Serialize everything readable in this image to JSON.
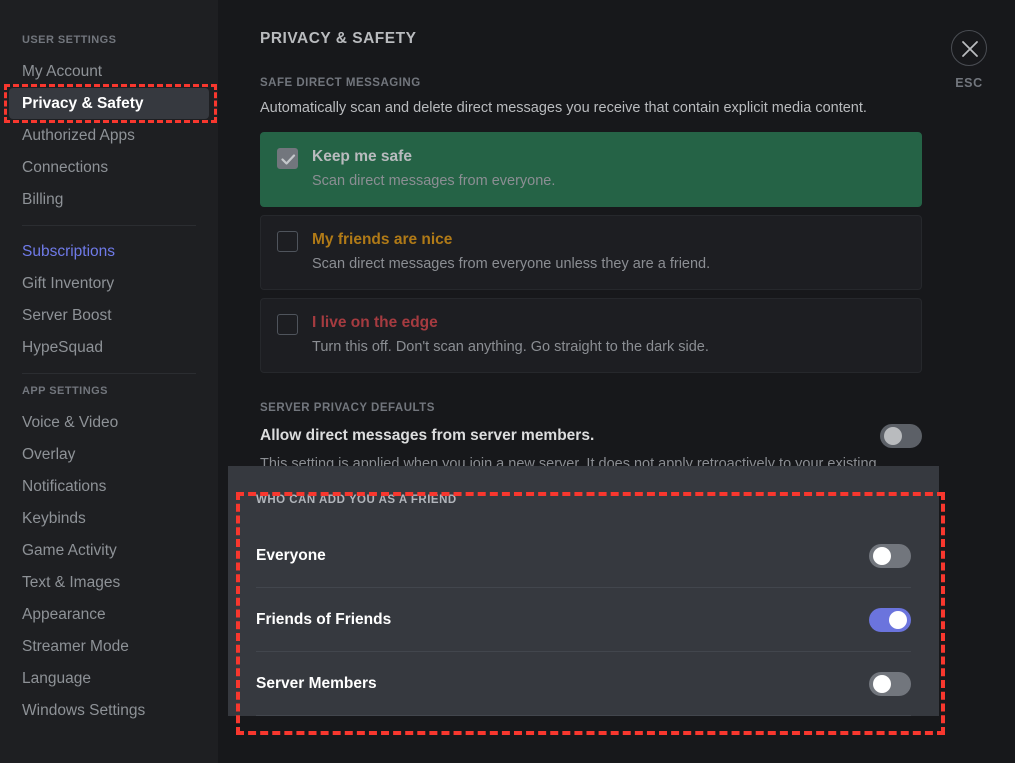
{
  "sidebar": {
    "user_settings_header": "USER SETTINGS",
    "app_settings_header": "APP SETTINGS",
    "user_items": [
      {
        "label": "My Account",
        "state": "normal"
      },
      {
        "label": "Privacy & Safety",
        "state": "active"
      },
      {
        "label": "Authorized Apps",
        "state": "normal"
      },
      {
        "label": "Connections",
        "state": "normal"
      },
      {
        "label": "Billing",
        "state": "normal"
      }
    ],
    "billing_items": [
      {
        "label": "Subscriptions",
        "state": "accent"
      },
      {
        "label": "Gift Inventory",
        "state": "normal"
      },
      {
        "label": "Server Boost",
        "state": "normal"
      },
      {
        "label": "HypeSquad",
        "state": "normal"
      }
    ],
    "app_items": [
      {
        "label": "Voice & Video",
        "state": "normal"
      },
      {
        "label": "Overlay",
        "state": "normal"
      },
      {
        "label": "Notifications",
        "state": "normal"
      },
      {
        "label": "Keybinds",
        "state": "normal"
      },
      {
        "label": "Game Activity",
        "state": "normal"
      },
      {
        "label": "Text & Images",
        "state": "normal"
      },
      {
        "label": "Appearance",
        "state": "normal"
      },
      {
        "label": "Streamer Mode",
        "state": "normal"
      },
      {
        "label": "Language",
        "state": "normal"
      },
      {
        "label": "Windows Settings",
        "state": "normal"
      }
    ]
  },
  "header": {
    "page_title": "PRIVACY & SAFETY"
  },
  "safe_dm": {
    "section_label": "SAFE DIRECT MESSAGING",
    "description": "Automatically scan and delete direct messages you receive that contain explicit media content.",
    "options": [
      {
        "title": "Keep me safe",
        "subtitle": "Scan direct messages from everyone.",
        "selected": true,
        "tone": "safe"
      },
      {
        "title": "My friends are nice",
        "subtitle": "Scan direct messages from everyone unless they are a friend.",
        "selected": false,
        "tone": "warn"
      },
      {
        "title": "I live on the edge",
        "subtitle": "Turn this off. Don't scan anything. Go straight to the dark side.",
        "selected": false,
        "tone": "danger"
      }
    ]
  },
  "server_privacy": {
    "section_label": "SERVER PRIVACY DEFAULTS",
    "title": "Allow direct messages from server members.",
    "note": "This setting is applied when you join a new server. It does not apply retroactively to your existing servers.",
    "toggle_on": false
  },
  "friend_requests": {
    "section_label": "WHO CAN ADD YOU AS A FRIEND",
    "rows": [
      {
        "label": "Everyone",
        "toggle_on": false
      },
      {
        "label": "Friends of Friends",
        "toggle_on": true
      },
      {
        "label": "Server Members",
        "toggle_on": false
      }
    ]
  },
  "close": {
    "icon": "close-icon",
    "label": "ESC"
  },
  "colors": {
    "accent_blue": "#6b74dd",
    "selected_green": "#256346",
    "warn_orange": "#b07a17",
    "danger_red": "#a53b40",
    "annotation_red": "#f8372e",
    "sidebar_bg": "#1e1f22",
    "main_bg": "#17181b",
    "panel_bg": "#36393f"
  }
}
